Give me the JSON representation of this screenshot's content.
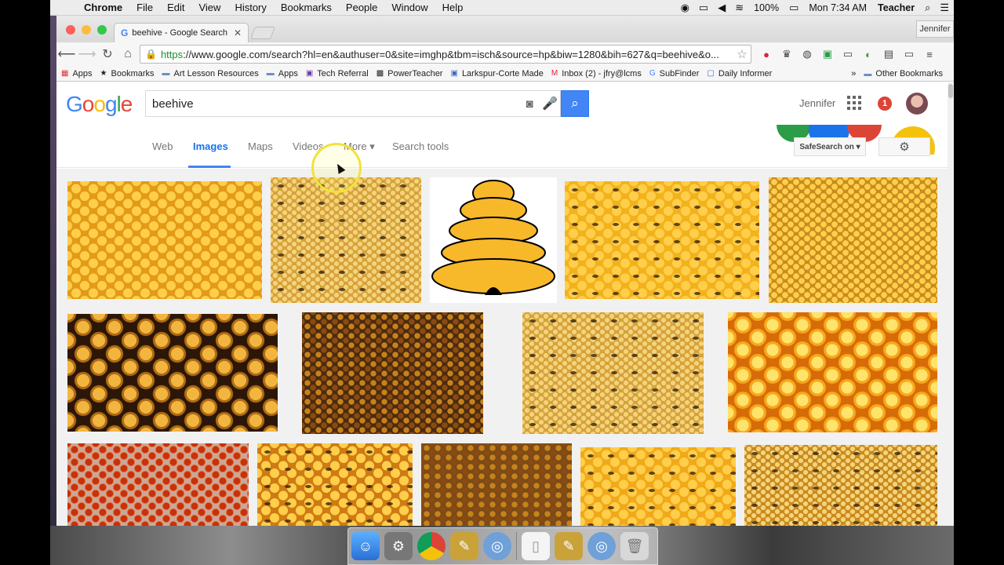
{
  "menubar": {
    "app": "Chrome",
    "items": [
      "File",
      "Edit",
      "View",
      "History",
      "Bookmarks",
      "People",
      "Window",
      "Help"
    ],
    "battery": "100%",
    "clock": "Mon 7:34 AM",
    "user": "Teacher"
  },
  "browser": {
    "tab_title": "beehive - Google Search",
    "profile": "Jennifer",
    "url_https": "https",
    "url_rest": "://www.google.com/search?hl=en&authuser=0&site=imghp&tbm=isch&source=hp&biw=1280&bih=627&q=beehive&o..."
  },
  "bookmarks": {
    "items": [
      "Apps",
      "Bookmarks",
      "Art Lesson Resources",
      "Apps",
      "Tech Referral",
      "PowerTeacher",
      "Larkspur-Corte Made",
      "Inbox (2) - jfry@lcms",
      "SubFinder",
      "Daily Informer"
    ],
    "more": "»",
    "other": "Other Bookmarks"
  },
  "google": {
    "logo": [
      "G",
      "o",
      "o",
      "g",
      "l",
      "e"
    ],
    "query": "beehive",
    "user_name": "Jennifer",
    "notifications": "1",
    "tabs": [
      "Web",
      "Images",
      "Maps",
      "Videos",
      "More ▾",
      "Search tools"
    ],
    "active_tab": "Images",
    "safesearch": "SafeSearch on ▾"
  },
  "colors": {
    "google_blue": "#4285f4",
    "notification_red": "#db4437"
  }
}
